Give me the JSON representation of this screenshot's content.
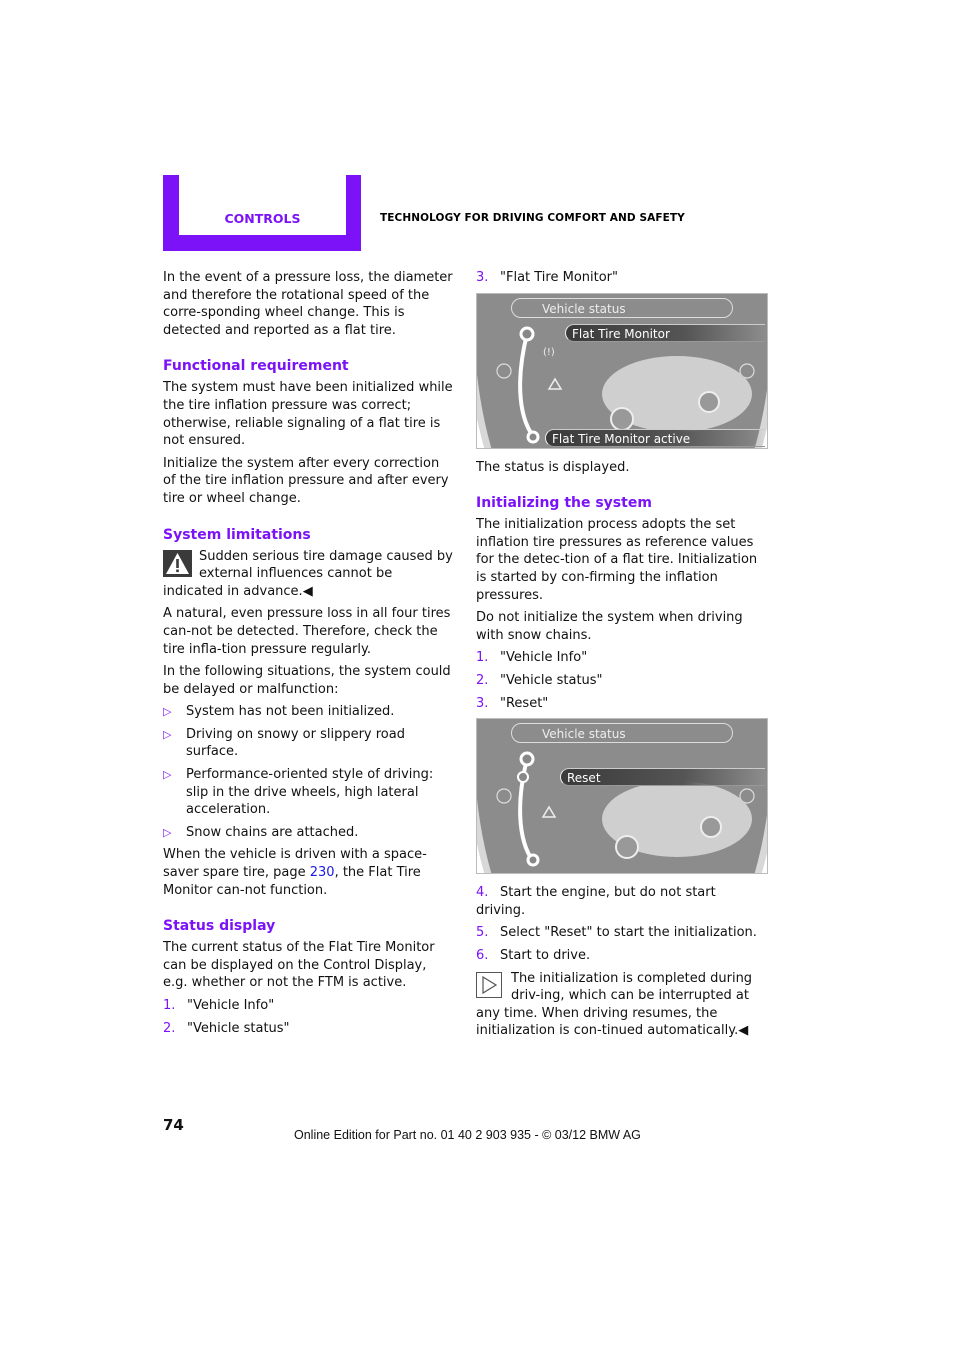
{
  "header": {
    "section": "CONTROLS",
    "title": "TECHNOLOGY FOR DRIVING COMFORT AND SAFETY",
    "accent_color": "#7b12f7"
  },
  "left": {
    "intro": "In the event of a pressure loss, the diameter and therefore the rotational speed of the corre-sponding wheel change. This is detected and reported as a flat tire.",
    "functional": {
      "heading": "Functional requirement",
      "p1": "The system must have been initialized while the tire inflation pressure was correct; otherwise, reliable signaling of a flat tire is not ensured.",
      "p2": "Initialize the system after every correction of the tire inflation pressure and after every tire or wheel change."
    },
    "limitations": {
      "heading": "System limitations",
      "warning": "Sudden serious tire damage caused by external influences cannot be indicated in advance.",
      "end_mark": "◀",
      "p1": "A natural, even pressure loss in all four tires can-not be detected. Therefore, check the tire infla-tion pressure regularly.",
      "p2": "In the following situations, the system could be delayed or malfunction:",
      "bullets": [
        "System has not been initialized.",
        "Driving on snowy or slippery road surface.",
        "Performance-oriented style of driving: slip in the drive wheels, high lateral acceleration.",
        "Snow chains are attached."
      ],
      "bullet_glyph": "▷",
      "p3_before": "When the vehicle is driven with a space-saver spare tire, page ",
      "p3_link": "230",
      "p3_after": ", the Flat Tire Monitor can-not function."
    },
    "status": {
      "heading": "Status display",
      "p1": "The current status of the Flat Tire Monitor can be displayed on the Control Display, e.g. whether or not the FTM is active.",
      "steps": [
        {
          "n": "1.",
          "t": "\"Vehicle Info\""
        },
        {
          "n": "2.",
          "t": "\"Vehicle status\""
        }
      ]
    }
  },
  "right": {
    "step3": {
      "n": "3.",
      "t": "\"Flat Tire Monitor\""
    },
    "screen1": {
      "header": "Vehicle status",
      "selected": "Flat Tire Monitor",
      "status": "Flat Tire Monitor active"
    },
    "status_shown": "The status is displayed.",
    "init": {
      "heading": "Initializing the system",
      "p1": "The initialization process adopts the set inflation tire pressures as reference values for the detec-tion of a flat tire. Initialization is started by con-firming the inflation pressures.",
      "p2": "Do not initialize the system when driving with snow chains.",
      "steps": [
        {
          "n": "1.",
          "t": "\"Vehicle Info\""
        },
        {
          "n": "2.",
          "t": "\"Vehicle status\""
        },
        {
          "n": "3.",
          "t": "\"Reset\""
        }
      ]
    },
    "screen2": {
      "header": "Vehicle status",
      "selected": "Reset"
    },
    "steps2": [
      {
        "n": "4.",
        "t": "Start the engine, but do not start driving."
      },
      {
        "n": "5.",
        "t": "Select \"Reset\" to start the initialization."
      },
      {
        "n": "6.",
        "t": "Start to drive."
      }
    ],
    "note": "The initialization is completed during driv-ing, which can be interrupted at any time. When driving resumes, the initialization is con-tinued automatically.",
    "end_mark": "◀"
  },
  "footer": {
    "page_number": "74",
    "edition": "Online Edition for Part no. 01 40 2 903 935 - © 03/12 BMW AG"
  }
}
